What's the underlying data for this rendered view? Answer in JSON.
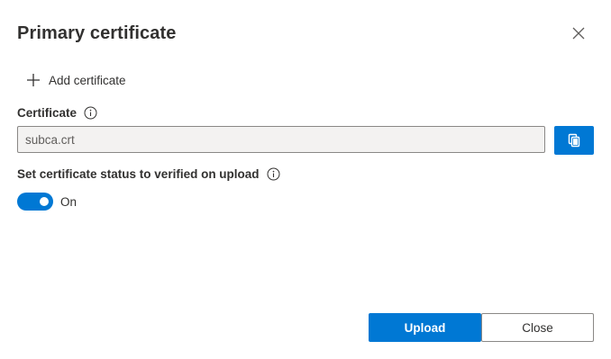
{
  "dialog": {
    "title": "Primary certificate",
    "close_icon": "close-icon"
  },
  "toolbar": {
    "add_certificate_label": "Add certificate",
    "add_icon": "plus-icon"
  },
  "certificate": {
    "label": "Certificate",
    "value": "subca.crt",
    "info_icon": "info-icon",
    "copy_icon": "copy-icon"
  },
  "verify": {
    "label": "Set certificate status to verified on upload",
    "info_icon": "info-icon",
    "toggle_state": "On",
    "toggle_on": true
  },
  "footer": {
    "upload_label": "Upload",
    "close_label": "Close"
  },
  "colors": {
    "accent": "#0078d4",
    "text": "#323130",
    "input_bg": "#f3f2f1",
    "border": "#8a8886"
  }
}
